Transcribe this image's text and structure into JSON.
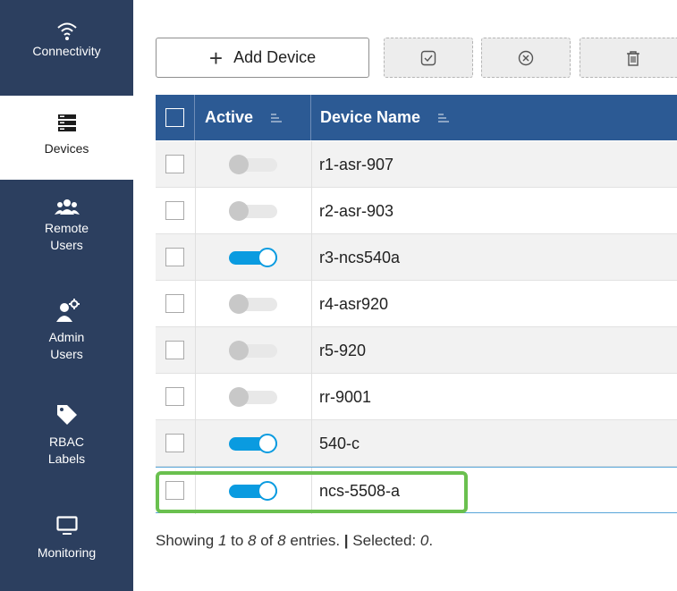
{
  "sidebar": {
    "items": [
      {
        "label": "Connectivity",
        "icon": "wifi-icon"
      },
      {
        "label": "Devices",
        "icon": "server-icon"
      },
      {
        "label": "Remote\nUsers",
        "icon": "users-icon"
      },
      {
        "label": "Admin\nUsers",
        "icon": "admin-user-icon"
      },
      {
        "label": "RBAC\nLabels",
        "icon": "tag-icon"
      },
      {
        "label": "Monitoring",
        "icon": "monitor-icon"
      }
    ]
  },
  "toolbar": {
    "add_label": "Add Device",
    "add_icon": "plus-icon",
    "icons": [
      "check-square-icon",
      "x-circle-icon",
      "trash-icon"
    ]
  },
  "table": {
    "columns": [
      "Active",
      "Device Name"
    ],
    "rows": [
      {
        "active": false,
        "name": "r1-asr-907"
      },
      {
        "active": false,
        "name": "r2-asr-903"
      },
      {
        "active": true,
        "name": "r3-ncs540a"
      },
      {
        "active": false,
        "name": "r4-asr920"
      },
      {
        "active": false,
        "name": "r5-920"
      },
      {
        "active": false,
        "name": "rr-9001"
      },
      {
        "active": true,
        "name": "540-c"
      },
      {
        "active": true,
        "name": "ncs-5508-a"
      }
    ]
  },
  "footer": {
    "showing": "Showing ",
    "from": "1",
    "to_word": " to ",
    "to": "8",
    "of_word": " of ",
    "total": "8",
    "entries": " entries. ",
    "bar": "|",
    "selected_label": " Selected: ",
    "selected": "0",
    "end": "."
  },
  "colors": {
    "sidebar_bg": "#2c3f5f",
    "header_bg": "#2c5a94",
    "toggle_on": "#0a9be0",
    "highlight": "#6ac04f"
  }
}
